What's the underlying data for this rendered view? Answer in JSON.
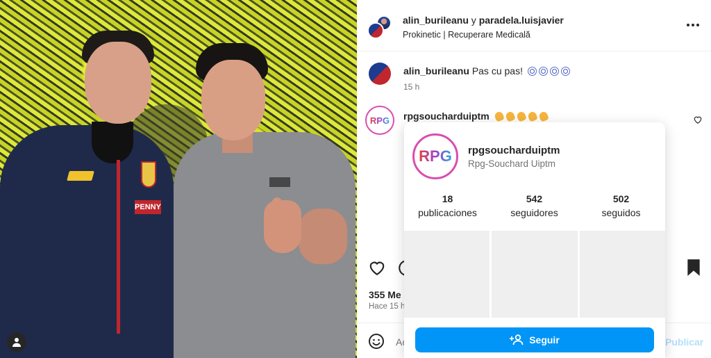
{
  "post": {
    "header": {
      "names_user1": "alin_burileanu",
      "names_joiner": " y ",
      "names_user2": "paradela.luisjavier",
      "location": "Prokinetic | Recuperare Medicală"
    },
    "caption": {
      "username": "alin_burileanu",
      "text": "Pas cu pas!",
      "emoji_icons": [
        "soccer-ball",
        "soccer-ball",
        "soccer-ball",
        "soccer-ball"
      ],
      "time": "15 h"
    },
    "comment": {
      "username": "rpgsoucharduiptm",
      "emoji_icons": [
        "clapping-hands",
        "clapping-hands",
        "clapping-hands",
        "clapping-hands",
        "clapping-hands"
      ],
      "avatar_text": "RPG"
    },
    "likes_text": "355 Me",
    "posted_text": "Hace 15 h",
    "add_comment_placeholder": "Ac",
    "publish_label": "Publicar",
    "photo_sponsor_text": "PENNY"
  },
  "hovercard": {
    "avatar_text": "RPG",
    "username": "rpgsoucharduiptm",
    "full_name": "Rpg-Souchard Uiptm",
    "stats": [
      {
        "number": "18",
        "label": "publicaciones"
      },
      {
        "number": "542",
        "label": "seguidores"
      },
      {
        "number": "502",
        "label": "seguidos"
      }
    ],
    "follow_label": "Seguir"
  },
  "colors": {
    "primary_button": "#0095f6",
    "publish_disabled": "#b2dffc",
    "secondary_text": "#737373"
  }
}
